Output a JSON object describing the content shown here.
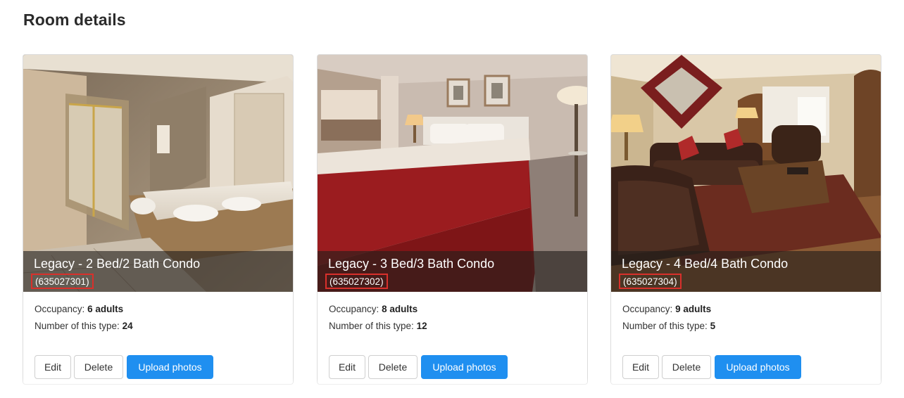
{
  "page": {
    "title": "Room details"
  },
  "labels": {
    "occupancy": "Occupancy:",
    "count": "Number of this type:"
  },
  "buttons": {
    "edit": "Edit",
    "delete": "Delete",
    "upload": "Upload photos"
  },
  "colors": {
    "primary": "#1f8ff0",
    "highlight_box": "#d9302b"
  },
  "rooms": [
    {
      "name": "Legacy - 2 Bed/2 Bath Condo",
      "code": "(635027301)",
      "occupancy": "6 adults",
      "count": "24",
      "photo": "bathroom-photo"
    },
    {
      "name": "Legacy - 3 Bed/3 Bath Condo",
      "code": "(635027302)",
      "occupancy": "8 adults",
      "count": "12",
      "photo": "bedroom-photo"
    },
    {
      "name": "Legacy - 4 Bed/4 Bath Condo",
      "code": "(635027304)",
      "occupancy": "9 adults",
      "count": "5",
      "photo": "living-room-photo"
    }
  ]
}
